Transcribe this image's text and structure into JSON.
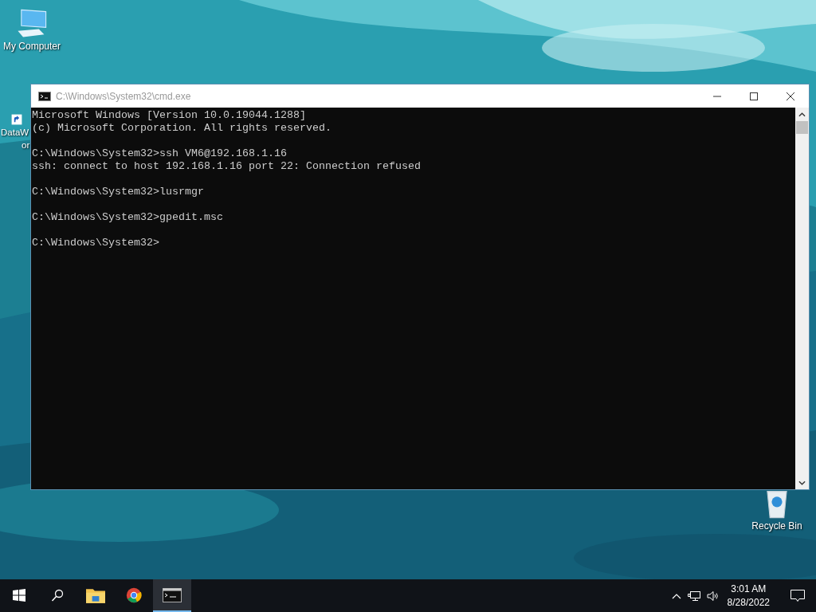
{
  "desktop": {
    "icons": [
      {
        "kind": "computer",
        "label": "My Computer"
      },
      {
        "kind": "shortcut",
        "label": "DataW",
        "label_2": "or"
      },
      {
        "kind": "recycle",
        "label": "Recycle Bin"
      }
    ]
  },
  "window": {
    "title": "C:\\Windows\\System32\\cmd.exe",
    "console": [
      [
        "Microsoft Windows [Version 10.0.19044.1288]",
        "(c) Microsoft Corporation. All rights reserved."
      ],
      [
        "C:\\Windows\\System32>ssh VM6@192.168.1.16",
        "ssh: connect to host 192.168.1.16 port 22: Connection refused"
      ],
      [
        "C:\\Windows\\System32>lusrmgr"
      ],
      [
        "C:\\Windows\\System32>gpedit.msc"
      ],
      [
        "C:\\Windows\\System32>"
      ]
    ]
  },
  "taskbar": {
    "apps": [
      {
        "kind": "explorer",
        "active": false
      },
      {
        "kind": "chrome",
        "active": false
      },
      {
        "kind": "cmd",
        "active": true
      }
    ],
    "time": "3:01 AM",
    "date": "8/28/2022"
  }
}
